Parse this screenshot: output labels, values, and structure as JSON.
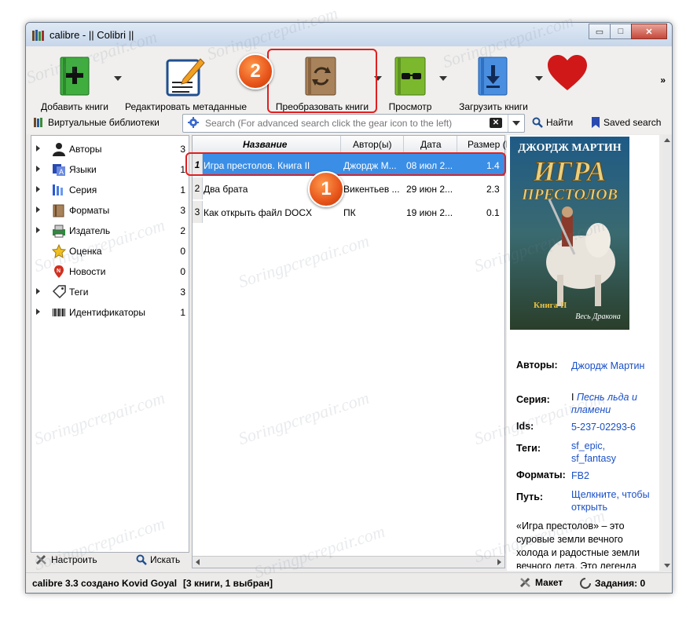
{
  "window": {
    "title": "calibre - || Colibri ||",
    "controls": {
      "minimize": "▭",
      "maximize": "□",
      "close": "✕"
    }
  },
  "toolbar": {
    "add_books": "Добавить книги",
    "edit_metadata": "Редактировать метаданные",
    "convert_books": "Преобразовать книги",
    "view": "Просмотр",
    "download_books": "Загрузить книги",
    "more": "»"
  },
  "searchbar": {
    "virtual_libraries": "Виртуальные библиотеки",
    "search_placeholder": "Search (For advanced search click the gear icon to the left)",
    "find": "Найти",
    "saved_search": "Saved search"
  },
  "tag_browser": {
    "items": [
      {
        "label": "Авторы",
        "count": "3",
        "icon": "person-icon",
        "expandable": true
      },
      {
        "label": "Языки",
        "count": "1",
        "icon": "languages-icon",
        "expandable": true
      },
      {
        "label": "Серия",
        "count": "1",
        "icon": "series-icon",
        "expandable": true
      },
      {
        "label": "Форматы",
        "count": "3",
        "icon": "book-formats-icon",
        "expandable": true
      },
      {
        "label": "Издатель",
        "count": "2",
        "icon": "publisher-icon",
        "expandable": true
      },
      {
        "label": "Оценка",
        "count": "0",
        "icon": "star-icon",
        "expandable": false
      },
      {
        "label": "Новости",
        "count": "0",
        "icon": "news-icon",
        "expandable": false
      },
      {
        "label": "Теги",
        "count": "3",
        "icon": "tag-icon",
        "expandable": true
      },
      {
        "label": "Идентификаторы",
        "count": "1",
        "icon": "barcode-icon",
        "expandable": true
      }
    ],
    "configure": "Настроить",
    "find": "Искать"
  },
  "book_list": {
    "columns": [
      "Название",
      "Автор(ы)",
      "Дата",
      "Размер (I"
    ],
    "rows": [
      {
        "n": "1",
        "title": "Игра престолов. Книга II",
        "author": "Джордж М...",
        "date": "08 июл 2...",
        "size": "1.4"
      },
      {
        "n": "2",
        "title": "Два брата",
        "author": "Викентьев ...",
        "date": "29 июн 2...",
        "size": "2.3"
      },
      {
        "n": "3",
        "title": "Как открыть файл DOCX",
        "author": "ПК",
        "date": "19 июн 2...",
        "size": "0.1"
      }
    ]
  },
  "cover": {
    "author": "ДЖОРДЖ МАРТИН",
    "title_line1": "ИГРА",
    "title_line2": "ПРЕСТОЛОВ",
    "book": "Книга II",
    "series_mark": "Весь Дракона"
  },
  "details": {
    "authors_label": "Авторы:",
    "authors_value": "Джордж Мартин",
    "series_label": "Серия:",
    "series_num": "I",
    "series_value": "Песнь льда и пламени",
    "ids_label": "Ids:",
    "ids_value": "5-237-02293-6",
    "tags_label": "Теги:",
    "tags_value": "sf_epic, sf_fantasy",
    "formats_label": "Форматы:",
    "formats_value": "FB2",
    "path_label": "Путь:",
    "path_value": "Щелкните, чтобы открыть",
    "description": "«Игра престолов» – это суровые земли вечного холода и радостные земли вечного лета. Это легенда о"
  },
  "statusbar": {
    "version": "calibre 3.3 создано Kovid Goyal",
    "selection": "[3 книги, 1 выбран]",
    "layout": "Макет",
    "jobs": "Задания: 0"
  },
  "annotations": {
    "badge1": "1",
    "badge2": "2",
    "frame_color": "#e02020"
  },
  "watermark": "Soringpcrepair.com",
  "colors": {
    "selection": "#3a8ee6",
    "link": "#1a50c8",
    "badge": "#e7541a"
  }
}
